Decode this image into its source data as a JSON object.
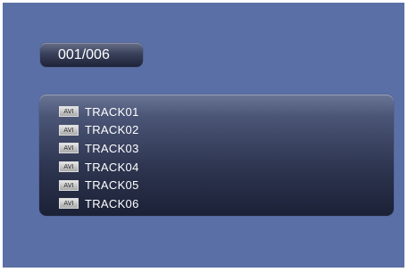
{
  "counter": {
    "text": "001/006"
  },
  "playlist": {
    "tracks": [
      {
        "type": "AVI",
        "name": "TRACK01"
      },
      {
        "type": "AVI",
        "name": "TRACK02"
      },
      {
        "type": "AVI",
        "name": "TRACK03"
      },
      {
        "type": "AVI",
        "name": "TRACK04"
      },
      {
        "type": "AVI",
        "name": "TRACK05"
      },
      {
        "type": "AVI",
        "name": "TRACK06"
      }
    ]
  },
  "colors": {
    "background": "#5a6fa5",
    "panel": "#2d3550",
    "text": "#ffffff"
  },
  "icons": {
    "file_type_icon": "avi-file-icon"
  }
}
